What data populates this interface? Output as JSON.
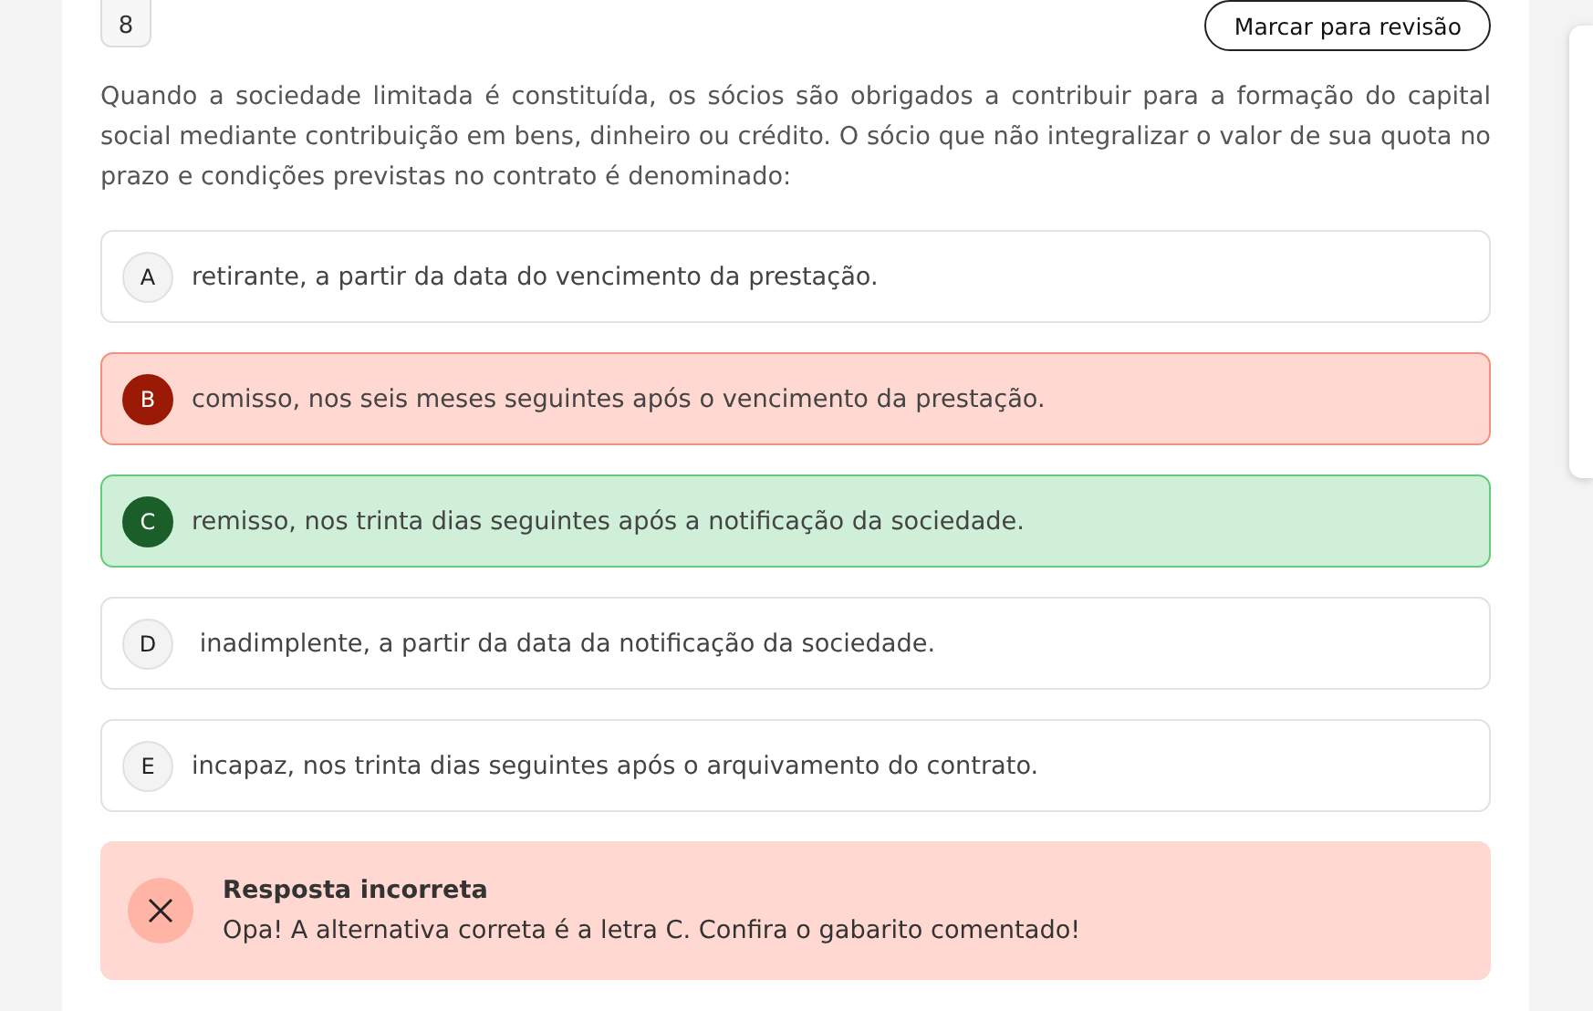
{
  "question": {
    "number": "8",
    "review_button": "Marcar para revisão",
    "text": "Quando a sociedade limitada é constituída, os sócios são obrigados a contribuir para a formação do capital social mediante contribuição em bens, dinheiro ou crédito. O sócio que não integralizar o valor de sua quota no prazo e condições previstas no contrato é denominado:"
  },
  "options": [
    {
      "letter": "A",
      "text": "retirante, a partir da data do vencimento da prestação.",
      "kind": "neutral"
    },
    {
      "letter": "B",
      "text": "comisso, nos seis meses seguintes após o vencimento da prestação.",
      "kind": "wrong"
    },
    {
      "letter": "C",
      "text": "remisso, nos trinta dias seguintes após a notificação da sociedade.",
      "kind": "correct"
    },
    {
      "letter": "D",
      "text": " inadimplente, a partir da data da notificação da sociedade.",
      "kind": "neutral"
    },
    {
      "letter": "E",
      "text": "incapaz, nos trinta dias seguintes após o arquivamento do contrato.",
      "kind": "neutral"
    }
  ],
  "feedback": {
    "kind": "incorrect",
    "title": "Resposta incorreta",
    "message": "Opa! A alternativa correta é a letra C. Confira o gabarito comentado!"
  }
}
